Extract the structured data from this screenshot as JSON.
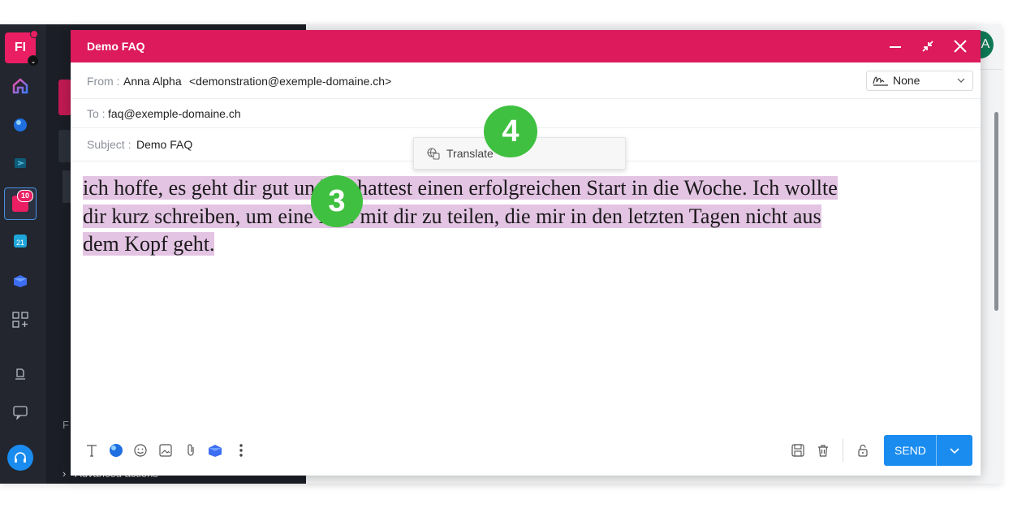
{
  "sidebar": {
    "avatar_initials": "FI",
    "calendar_badge": "10",
    "user_avatar": "A"
  },
  "background": {
    "left_label": "F",
    "advanced_label": "Advanced actions"
  },
  "compose": {
    "title": "Demo FAQ",
    "from_label": "From :",
    "from_name": "Anna Alpha",
    "from_email": "<demonstration@exemple-domaine.ch>",
    "signature_value": "None",
    "to_label": "To :",
    "to_value": "faq@exemple-domaine.ch",
    "subject_label": "Subject :",
    "subject_value": "Demo FAQ",
    "body_line1": "ich hoffe, es geht dir gut und du hattest einen erfolgreichen Start in die Woche. Ich wollte",
    "body_line2": "dir kurz schreiben, um eine Idee mit dir zu teilen, die mir in den letzten Tagen nicht aus",
    "body_line3": "dem Kopf geht.",
    "context_menu_item": "Translate",
    "send_label": "SEND"
  },
  "annotations": {
    "step3": "3",
    "step4": "4"
  },
  "colors": {
    "accent": "#dc1a5c",
    "send": "#1a8cf0",
    "highlight": "#e3c4e3",
    "badge": "#3fc040"
  }
}
